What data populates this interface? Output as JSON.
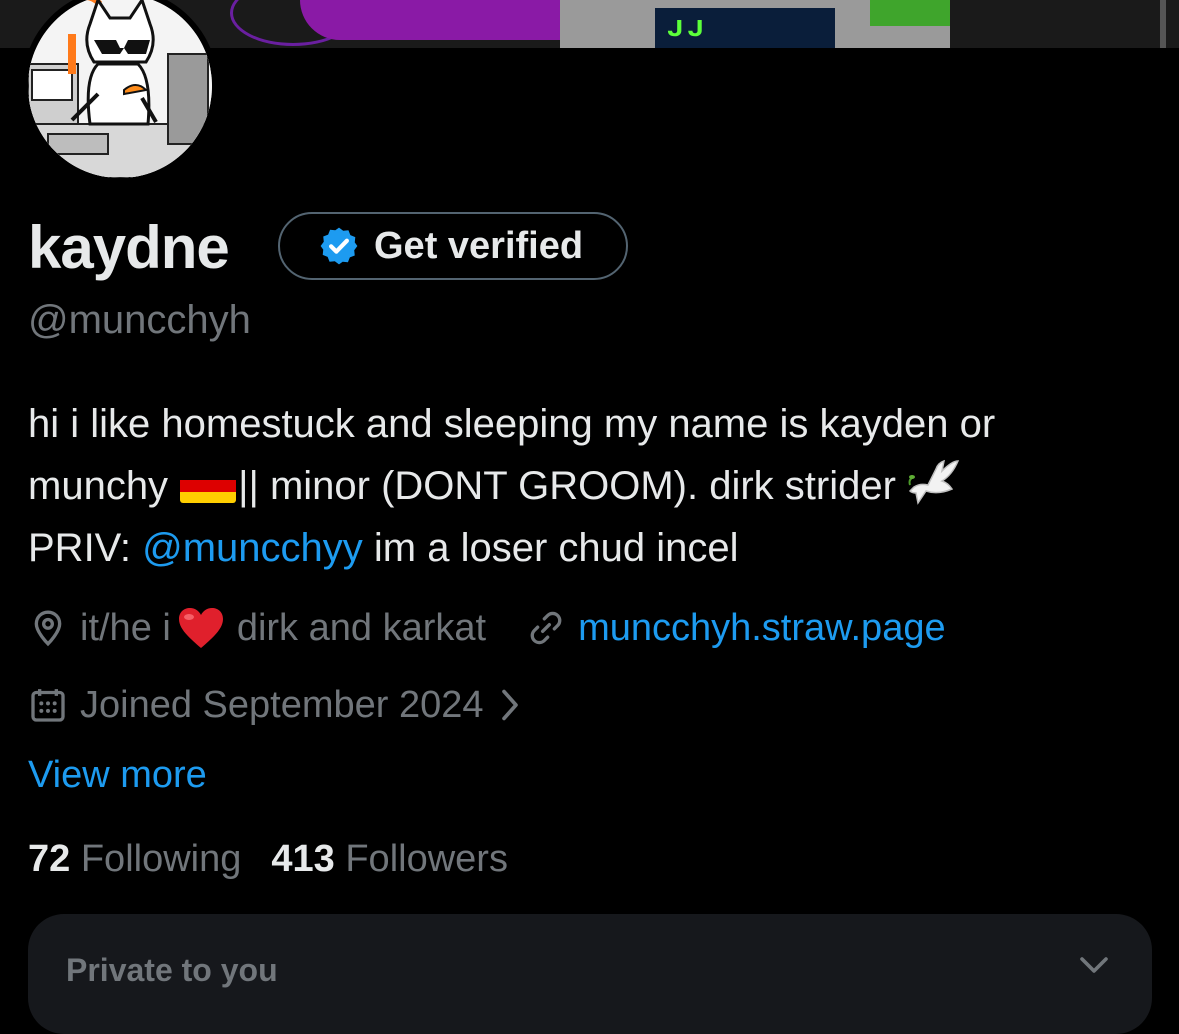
{
  "profile": {
    "display_name": "kaydne",
    "handle": "@muncchyh",
    "get_verified_label": "Get verified",
    "bio": {
      "line1": "hi i like homestuck and sleeping my name is kayden or",
      "line2_a": "munchy",
      "line2_b": "|| minor (DONT GROOM). dirk strider",
      "line3_a": "PRIV: ",
      "line3_mention": "@muncchyy",
      "line3_b": " im a loser chud incel"
    },
    "location_a": "it/he i",
    "location_b": "dirk and karkat",
    "website": "muncchyh.straw.page",
    "joined": "Joined September 2024",
    "view_more": "View more",
    "following_count": "72",
    "following_label": "Following",
    "followers_count": "413",
    "followers_label": "Followers"
  },
  "private_card": {
    "title": "Private to you"
  },
  "colors": {
    "accent": "#1d9bf0",
    "muted": "#71767b",
    "text": "#e7e9ea",
    "background": "#000000"
  },
  "icons": [
    "location-pin-icon",
    "link-icon",
    "calendar-icon",
    "chevron-right-icon",
    "verified-badge-icon",
    "heart-emoji-icon",
    "germany-flag-icon",
    "dove-emoji-icon",
    "chevron-down-icon"
  ]
}
